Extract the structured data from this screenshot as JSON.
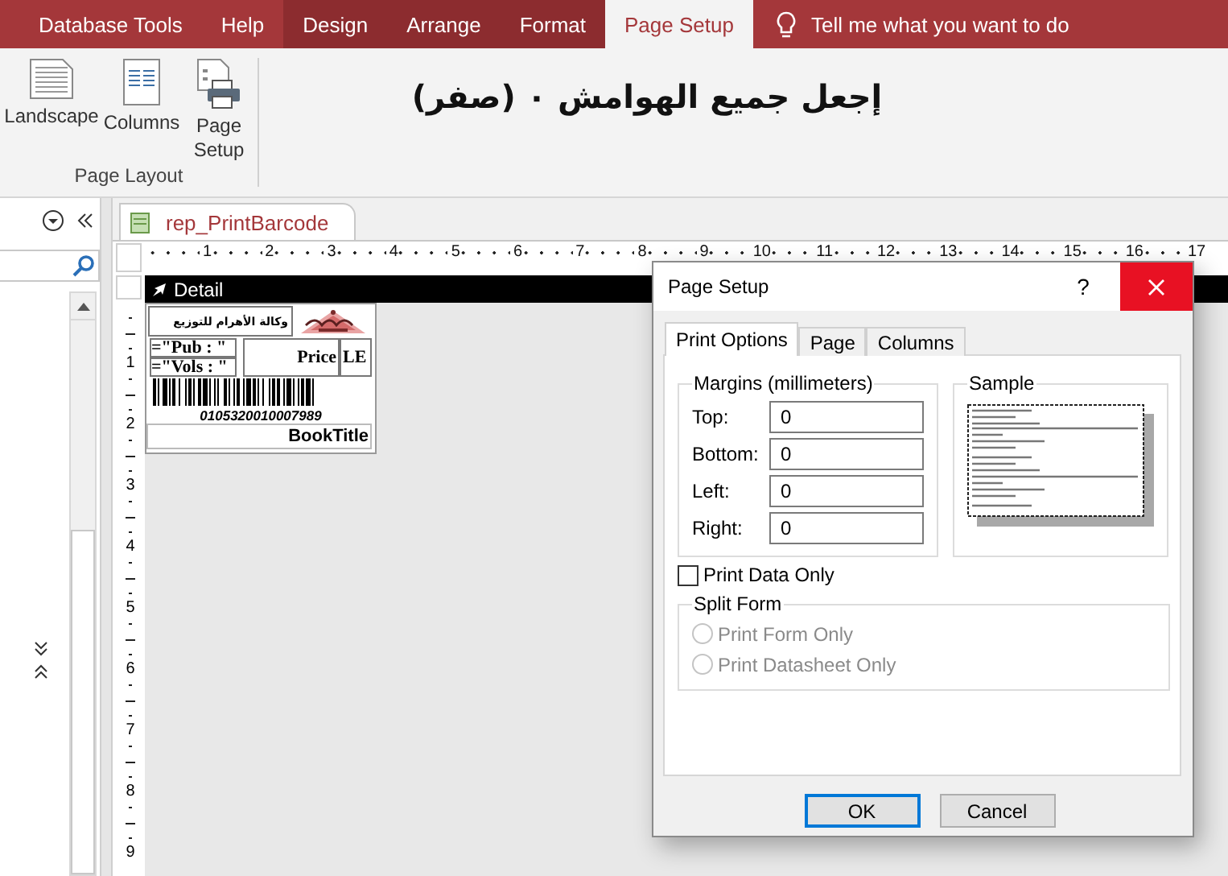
{
  "ribbon_tabs": [
    {
      "label": "Database Tools",
      "selected": false,
      "contextual": false
    },
    {
      "label": "Help",
      "selected": false,
      "contextual": false
    },
    {
      "label": "Design",
      "selected": false,
      "contextual": true
    },
    {
      "label": "Arrange",
      "selected": false,
      "contextual": true
    },
    {
      "label": "Format",
      "selected": false,
      "contextual": true
    },
    {
      "label": "Page Setup",
      "selected": true,
      "contextual": true
    }
  ],
  "tell_me": "Tell me what you want to do",
  "ribbon": {
    "buttons": [
      {
        "label": "Landscape",
        "kind": "landscape"
      },
      {
        "label": "Columns",
        "kind": "columns"
      },
      {
        "label": "Page Setup",
        "kind": "page_setup"
      }
    ],
    "group_label": "Page Layout"
  },
  "annotation": "إجعل جميع الهوامش ٠ (صفر)",
  "document_tab": "rep_PrintBarcode",
  "ruler_numbers": [
    "1",
    "2",
    "3",
    "4",
    "5",
    "6",
    "7",
    "8",
    "9",
    "10",
    "11",
    "12",
    "13",
    "14",
    "15",
    "16",
    "17"
  ],
  "vertical_ruler_numbers": [
    "1",
    "2",
    "3",
    "4",
    "5",
    "6",
    "7",
    "8",
    "9"
  ],
  "section": "Detail",
  "report": {
    "publisher": "وكالة الأهرام للتوزيع",
    "pub_field": "=\"Pub : \"",
    "vols_field": "=\"Vols : \"",
    "price_label": "Price",
    "currency": "LE",
    "barcode_number": "0105320010007989",
    "title_field": "BookTitle"
  },
  "dialog": {
    "title": "Page Setup",
    "help": "?",
    "tabs": [
      {
        "label": "Print Options",
        "selected": true
      },
      {
        "label": "Page",
        "selected": false
      },
      {
        "label": "Columns",
        "selected": false
      }
    ],
    "margins_title": "Margins (millimeters)",
    "margins": [
      {
        "label": "Top:",
        "value": "0"
      },
      {
        "label": "Bottom:",
        "value": "0"
      },
      {
        "label": "Left:",
        "value": "0"
      },
      {
        "label": "Right:",
        "value": "0"
      }
    ],
    "sample_title": "Sample",
    "print_data_only": {
      "label": "Print Data Only",
      "checked": false
    },
    "split_form": {
      "title": "Split Form",
      "options": [
        {
          "label": "Print Form Only",
          "selected": false,
          "disabled": true
        },
        {
          "label": "Print Datasheet Only",
          "selected": false,
          "disabled": true
        }
      ]
    },
    "buttons": [
      {
        "label": "OK",
        "default": true
      },
      {
        "label": "Cancel",
        "default": false
      }
    ]
  }
}
